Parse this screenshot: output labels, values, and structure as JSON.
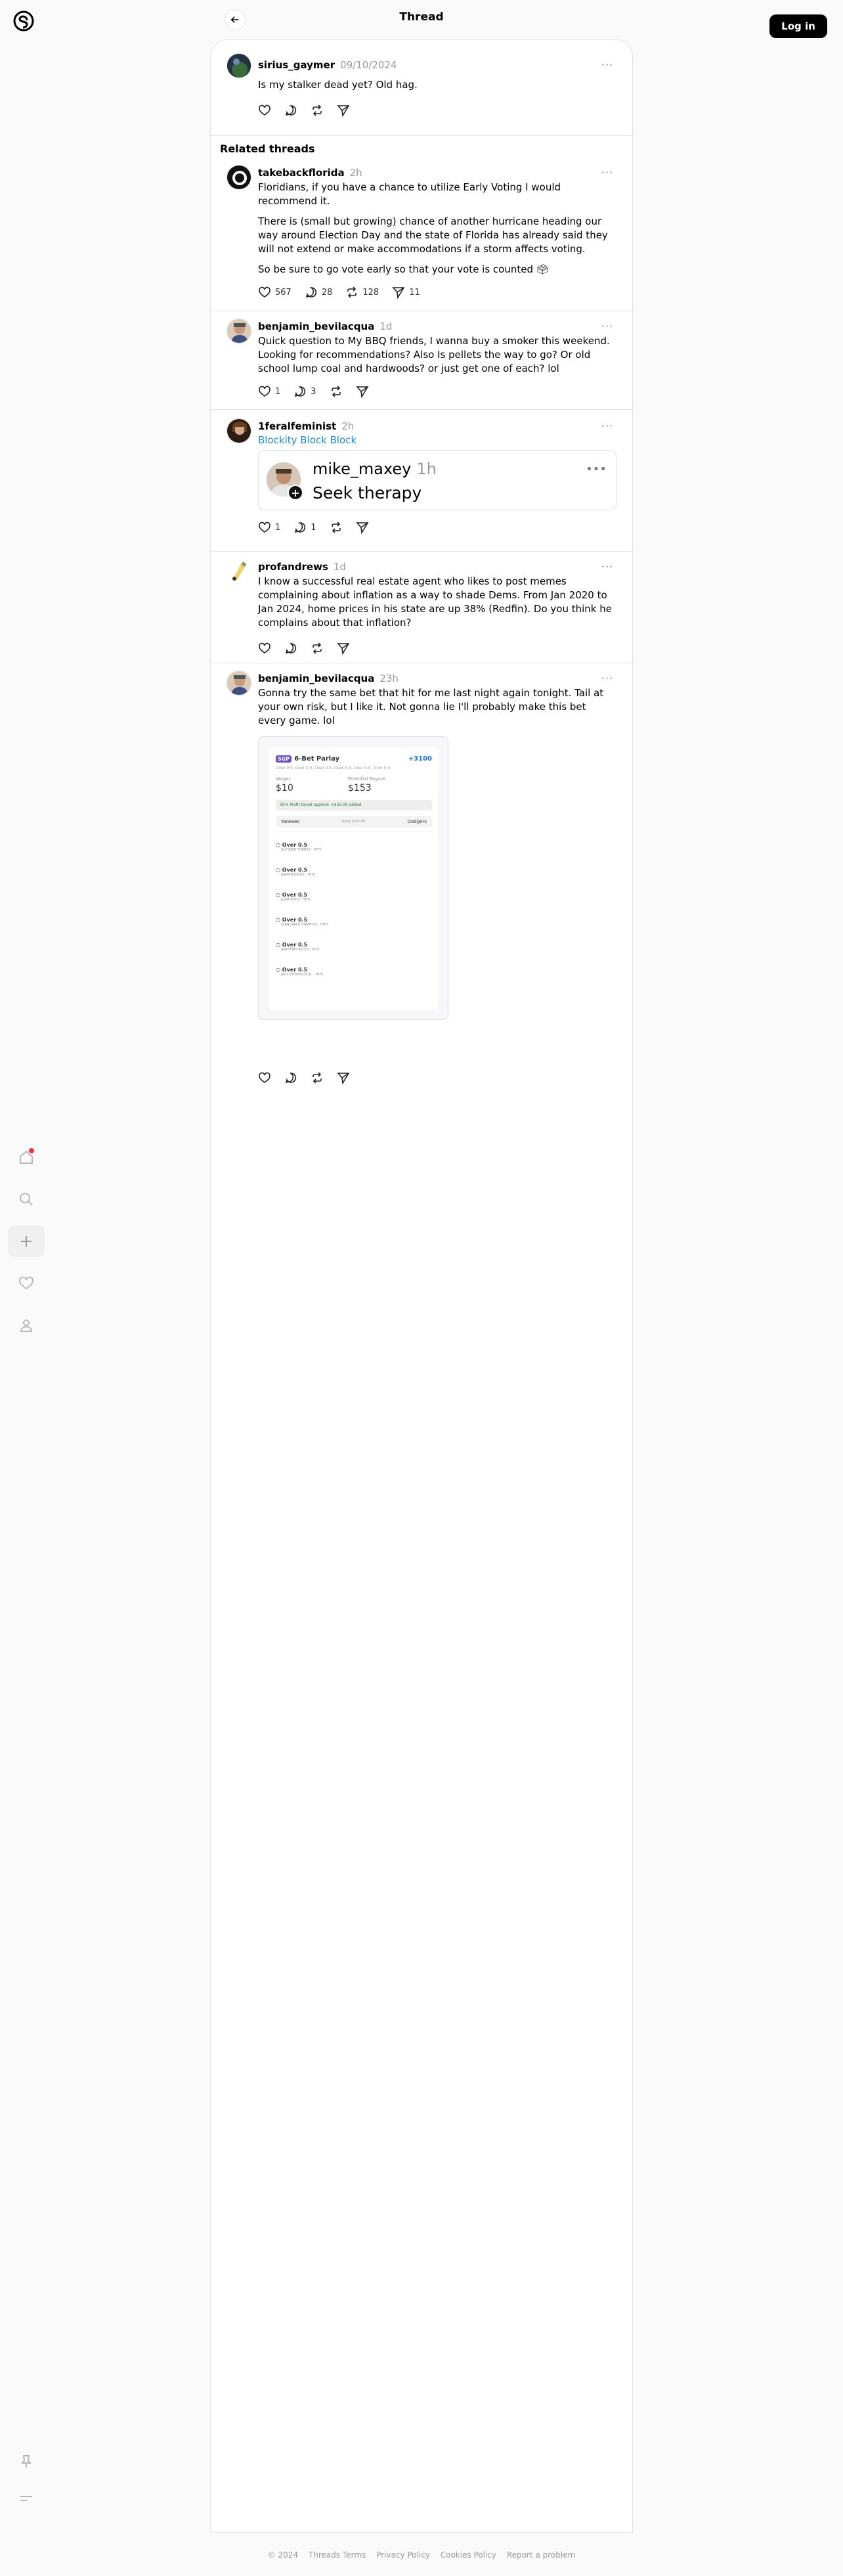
{
  "header": {
    "title": "Thread",
    "login_label": "Log in"
  },
  "main_post": {
    "user": "sirius_gaymer",
    "time": "09/10/2024",
    "text": "Is my stalker dead yet? Old hag."
  },
  "related": {
    "title": "Related threads",
    "posts": [
      {
        "user": "takebackflorida",
        "time": "2h",
        "paragraphs": [
          "Floridians, if you have a chance to utilize Early Voting I would recommend it.",
          "There is (small but growing) chance of another hurricane heading our way around Election Day and the state of Florida has already said they will not extend or make accommodations if a storm affects voting.",
          "So be sure to go vote early so that your vote is counted 🗳"
        ],
        "likes": "567",
        "replies": "28",
        "reposts": "128",
        "shares": "11"
      },
      {
        "user": "benjamin_bevilacqua",
        "time": "1d",
        "text": "Quick question to My BBQ friends, I wanna buy a smoker this weekend. Looking for recommendations? Also Is pellets the way to go? Or old school lump coal and hardwoods? or just get one of each? lol",
        "likes": "1",
        "replies": "3"
      },
      {
        "user": "1feralfeminist",
        "time": "2h",
        "link_text": "Blockity Block Block",
        "quote": {
          "user": "mike_maxey",
          "time": "1h",
          "text": "Seek therapy"
        },
        "likes": "1",
        "replies": "1"
      },
      {
        "user": "profandrews",
        "time": "1d",
        "text": "I know a successful real estate agent who likes to post memes complaining about inflation as a way to shade Dems. From Jan 2020 to Jan 2024, home prices in his state are up 38% (Redfin). Do you think he complains about that inflation?"
      },
      {
        "user": "benjamin_bevilacqua",
        "time": "23h",
        "text": "Gonna try the same bet that hit for me last night again tonight. Tail at your own risk, but I like it. Not gonna lie I'll probably make this bet every game. lol",
        "bet_slip": {
          "badge": "SGP",
          "title": "6-Bet Parlay",
          "odds": "+3100",
          "subtitle": "Over 0.5, Over 0.5, Over 0.5, Over 0.5, Over 0.5, Over 0.5",
          "wager_label": "Wager",
          "wager": "$10",
          "payout_label": "Potential Payout",
          "payout": "$153",
          "boost": "30% Profit Boost applied: +$33.00 added",
          "team1": "Yankees",
          "team2": "Dodgers",
          "game_info": "Today 8:08 PM",
          "legs": [
            {
              "line": "Over 0.5",
              "player": "GLEYBER TORRES - HITS"
            },
            {
              "line": "Over 0.5",
              "player": "AARON JUDGE - HITS"
            },
            {
              "line": "Over 0.5",
              "player": "JUAN SOTO - HITS"
            },
            {
              "line": "Over 0.5",
              "player": "GIANCARLO STANTON - HITS"
            },
            {
              "line": "Over 0.5",
              "player": "ANTHONY RIZZO - HITS"
            },
            {
              "line": "Over 0.5",
              "player": "JAZZ CHISHOLM JR. - HITS"
            }
          ]
        }
      }
    ]
  },
  "footer": [
    "© 2024",
    "Threads Terms",
    "Privacy Policy",
    "Cookies Policy",
    "Report a problem"
  ],
  "colors": {
    "accent": "#000000",
    "link": "#1a8cd8",
    "notification": "#ff3040"
  }
}
